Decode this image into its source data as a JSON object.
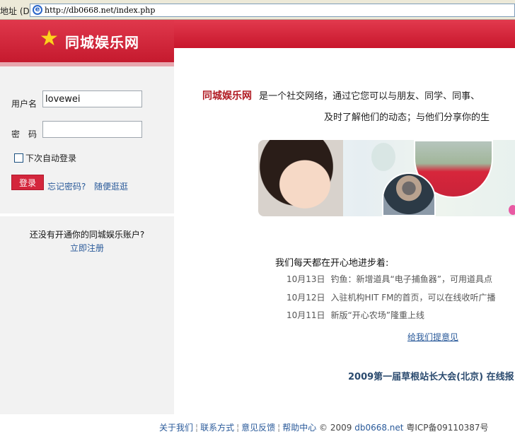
{
  "browser": {
    "address_label": "地址 (D)",
    "url": "http://db0668.net/index.php"
  },
  "logo": {
    "text": "同城娱乐网"
  },
  "login": {
    "username_label": "用户名",
    "username_value": "lovewei",
    "password_label": "密　码",
    "password_value": "",
    "remember_label": "下次自动登录",
    "login_button": "登录",
    "forgot_link": "忘记密码?",
    "browse_link": "随便逛逛",
    "no_account": "还没有开通你的同城娱乐账户?",
    "register_link": "立即注册"
  },
  "intro": {
    "brand": "同城娱乐网",
    "line1": "是一个社交网络，通过它您可以与朋友、同学、同事、",
    "line2": "及时了解他们的动态；与他们分享你的生"
  },
  "news": {
    "title": "我们每天都在开心地进步着:",
    "items": [
      {
        "date": "10月13日",
        "text": "钓鱼：新增道具“电子捕鱼器”，可用道具点"
      },
      {
        "date": "10月12日",
        "text": "入驻机构HIT FM的首页，可以在线收听广播"
      },
      {
        "date": "10月11日",
        "text": "新版“开心农场”隆重上线"
      }
    ],
    "feedback_link": "给我们提意见",
    "conference": "2009第一届草根站长大会(北京) 在线报"
  },
  "footer": {
    "about": "关于我们",
    "contact": "联系方式",
    "feedback": "意见反馈",
    "help": "帮助中心",
    "copyright": "© 2009",
    "domain": "db0668.net",
    "icp": "粤ICP备09110387号"
  },
  "colors": {
    "brand_red": "#c8162c",
    "link_blue": "#2a5a9a"
  }
}
